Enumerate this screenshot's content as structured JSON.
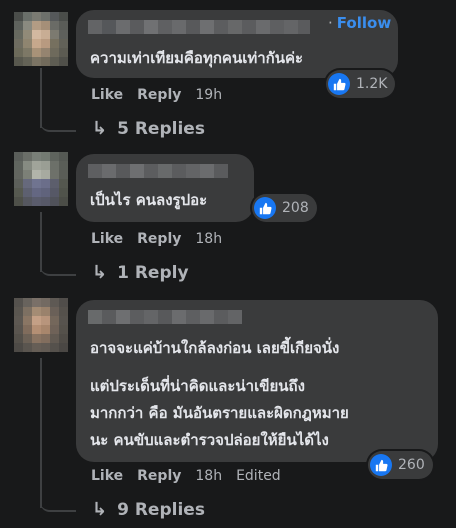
{
  "comments": [
    {
      "follow_label": "Follow",
      "follow_sep": "·",
      "text_lines": [
        "ความเท่าเทียมคือทุกคนเท่ากันค่ะ"
      ],
      "reaction_count": "1.2K",
      "actions": {
        "like": "Like",
        "reply": "Reply",
        "time": "19h"
      },
      "replies_label": "5 Replies"
    },
    {
      "text_lines": [
        "เป็นไร คนลงรูปอะ"
      ],
      "reaction_count": "208",
      "actions": {
        "like": "Like",
        "reply": "Reply",
        "time": "18h"
      },
      "replies_label": "1 Reply"
    },
    {
      "text_lines": [
        "อาจจะแค่บ้านใกล้ลงก่อน เลยขี้เกียจนั่ง",
        "แต่ประเด็นที่น่าคิดและน่าเขียนถึง",
        "มากกว่า คือ มันอันตรายและผิดกฎหมาย",
        "นะ คนขับและตำรวจปล่อยให้ยืนได้ไง"
      ],
      "reaction_count": "260",
      "actions": {
        "like": "Like",
        "reply": "Reply",
        "time": "18h",
        "edited": "Edited"
      },
      "replies_label": "9 Replies"
    }
  ],
  "icons": {
    "reaction": "like-thumb-icon",
    "reply_arrow": "reply-arrow-icon"
  },
  "colors": {
    "background": "#18191a",
    "bubble": "#3a3b3c",
    "link": "#3a8eee",
    "like": "#1877f2",
    "muted": "#b0b3b8"
  }
}
